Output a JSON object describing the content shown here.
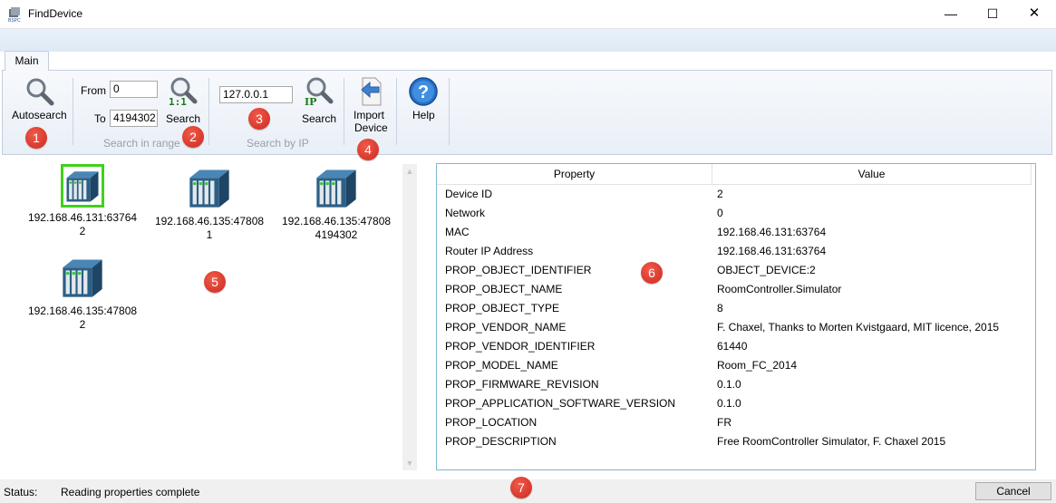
{
  "window": {
    "title": "FindDevice",
    "minimize": "—",
    "maximize": "☐",
    "close": "✕"
  },
  "ribbon": {
    "tab_main": "Main",
    "autosearch_label": "Autosearch",
    "range": {
      "from_label": "From",
      "from_value": "0",
      "to_label": "To",
      "to_value": "4194302",
      "search_label": "Search",
      "icon_badge": "1:1",
      "group_label": "Search in range"
    },
    "ip": {
      "value": "127.0.0.1",
      "search_label": "Search",
      "icon_badge": "IP",
      "group_label": "Search by IP"
    },
    "import": {
      "line1": "Import",
      "line2": "Device"
    },
    "help_label": "Help"
  },
  "markers": [
    "1",
    "2",
    "3",
    "4",
    "5",
    "6",
    "7"
  ],
  "devices": [
    {
      "address": "192.168.46.131:63764",
      "id": "2"
    },
    {
      "address": "192.168.46.135:47808",
      "id": "1"
    },
    {
      "address": "192.168.46.135:47808",
      "id": "4194302"
    },
    {
      "address": "192.168.46.135:47808",
      "id": "2"
    }
  ],
  "grid": {
    "headers": {
      "property": "Property",
      "value": "Value"
    },
    "rows": [
      {
        "property": "Device ID",
        "value": "2"
      },
      {
        "property": "Network",
        "value": "0"
      },
      {
        "property": "MAC",
        "value": "192.168.46.131:63764"
      },
      {
        "property": "Router IP Address",
        "value": "192.168.46.131:63764"
      },
      {
        "property": "PROP_OBJECT_IDENTIFIER",
        "value": "OBJECT_DEVICE:2"
      },
      {
        "property": "PROP_OBJECT_NAME",
        "value": "RoomController.Simulator"
      },
      {
        "property": "PROP_OBJECT_TYPE",
        "value": "8"
      },
      {
        "property": "PROP_VENDOR_NAME",
        "value": "F. Chaxel, Thanks to Morten Kvistgaard, MIT licence, 2015"
      },
      {
        "property": "PROP_VENDOR_IDENTIFIER",
        "value": "61440"
      },
      {
        "property": "PROP_MODEL_NAME",
        "value": "Room_FC_2014"
      },
      {
        "property": "PROP_FIRMWARE_REVISION",
        "value": "0.1.0"
      },
      {
        "property": "PROP_APPLICATION_SOFTWARE_VERSION",
        "value": "0.1.0"
      },
      {
        "property": "PROP_LOCATION",
        "value": "FR"
      },
      {
        "property": "PROP_DESCRIPTION",
        "value": "Free RoomController Simulator, F. Chaxel 2015"
      }
    ]
  },
  "status": {
    "label": "Status:",
    "text": "Reading properties complete",
    "cancel_label": "Cancel"
  },
  "colors": {
    "marker": "#d9362a",
    "selection": "#3fd21b",
    "grid_border": "#7fb8d1"
  },
  "icons": [
    "app-icon",
    "search-icon",
    "search-range-icon",
    "search-ip-icon",
    "import-device-icon",
    "help-icon",
    "device-icon"
  ]
}
